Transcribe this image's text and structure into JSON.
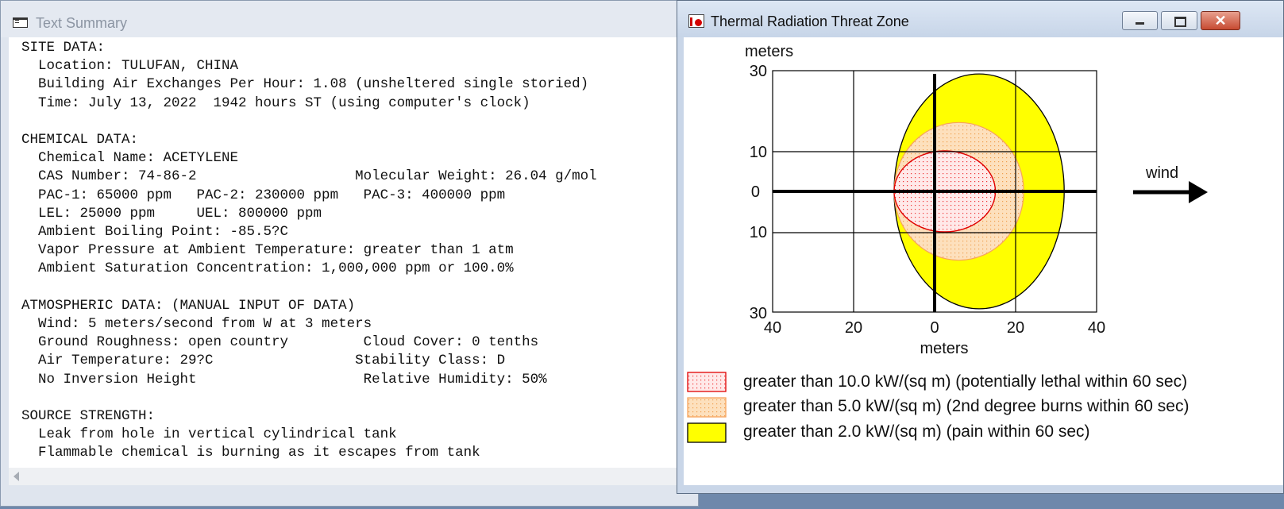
{
  "text_window": {
    "title": "Text Summary",
    "summary_lines": [
      "SITE DATA:",
      "  Location: TULUFAN, CHINA",
      "  Building Air Exchanges Per Hour: 1.08 (unsheltered single storied)",
      "  Time: July 13, 2022  1942 hours ST (using computer's clock)",
      "",
      "CHEMICAL DATA:",
      "  Chemical Name: ACETYLENE",
      "  CAS Number: 74-86-2                   Molecular Weight: 26.04 g/mol",
      "  PAC-1: 65000 ppm   PAC-2: 230000 ppm   PAC-3: 400000 ppm",
      "  LEL: 25000 ppm     UEL: 800000 ppm",
      "  Ambient Boiling Point: -85.5?C",
      "  Vapor Pressure at Ambient Temperature: greater than 1 atm",
      "  Ambient Saturation Concentration: 1,000,000 ppm or 100.0%",
      "",
      "ATMOSPHERIC DATA: (MANUAL INPUT OF DATA)",
      "  Wind: 5 meters/second from W at 3 meters",
      "  Ground Roughness: open country         Cloud Cover: 0 tenths",
      "  Air Temperature: 29?C                 Stability Class: D",
      "  No Inversion Height                    Relative Humidity: 50%",
      "",
      "SOURCE STRENGTH:",
      "  Leak from hole in vertical cylindrical tank",
      "  Flammable chemical is burning as it escapes from tank"
    ]
  },
  "threat_window": {
    "title": "Thermal Radiation Threat Zone",
    "close_symbol": "✕",
    "wind_label": "wind",
    "plot": {
      "y_unit_label": "meters",
      "x_unit_label": "meters",
      "x_ticks": [
        "40",
        "20",
        "0",
        "20",
        "40"
      ],
      "y_ticks": [
        "30",
        "10",
        "0",
        "10",
        "30"
      ],
      "zones": [
        {
          "name": "yellow zone",
          "x_min": -10,
          "x_max": 32,
          "y_half": 29,
          "color": "#ffff00"
        },
        {
          "name": "orange zone",
          "x_min": -10,
          "x_max": 22,
          "y_half": 17,
          "color": "#fddcb4"
        },
        {
          "name": "red zone",
          "x_min": -10,
          "x_max": 15,
          "y_half": 10,
          "color": "#ffe4e4"
        }
      ]
    },
    "legend": [
      {
        "label": "greater than 10.0 kW/(sq m) (potentially lethal within 60 sec)",
        "color": "#ff5555"
      },
      {
        "label": "greater than 5.0 kW/(sq m) (2nd degree burns within 60 sec)",
        "color": "#fbc48c"
      },
      {
        "label": "greater than 2.0 kW/(sq m) (pain within 60 sec)",
        "color": "#ffff00"
      }
    ]
  }
}
